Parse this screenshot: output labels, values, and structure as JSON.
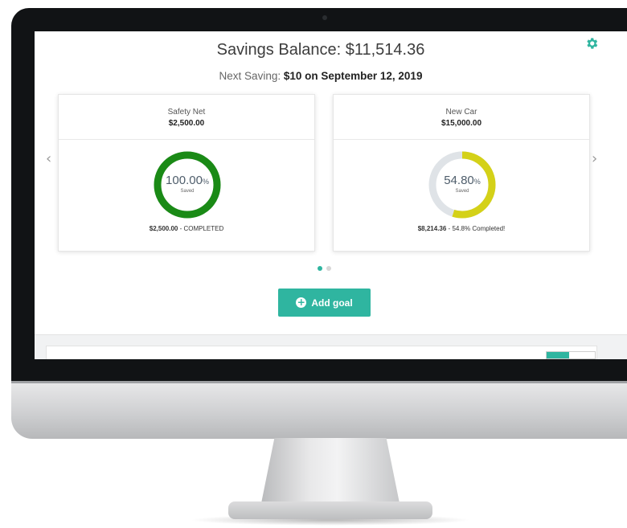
{
  "header": {
    "balance_title": "Savings Balance: $11,514.36",
    "next_saving_label": "Next Saving:",
    "next_saving_value": "$10 on September 12, 2019"
  },
  "goals": [
    {
      "name": "Safety Net",
      "amount": "$2,500.00",
      "percent": "100.00",
      "percent_unit": "%",
      "saved_label": "Saved",
      "progress": 1.0,
      "ring_color": "#1a8a16",
      "footer_amount": "$2,500.00",
      "footer_status": " - COMPLETED"
    },
    {
      "name": "New Car",
      "amount": "$15,000.00",
      "percent": "54.80",
      "percent_unit": "%",
      "saved_label": "Saved",
      "progress": 0.548,
      "ring_color": "#d4d118",
      "footer_amount": "$8,214.36",
      "footer_status": " - 54.8% Completed!"
    }
  ],
  "carousel": {
    "prev_icon": "chevron-left-icon",
    "next_icon": "chevron-right-icon",
    "active_page": 1,
    "page_count": 2
  },
  "actions": {
    "add_goal_label": "Add goal",
    "add_goal_icon": "plus-circle-icon"
  },
  "colors": {
    "accent": "#2fb5a0",
    "ring_track": "#dfe3e7"
  }
}
